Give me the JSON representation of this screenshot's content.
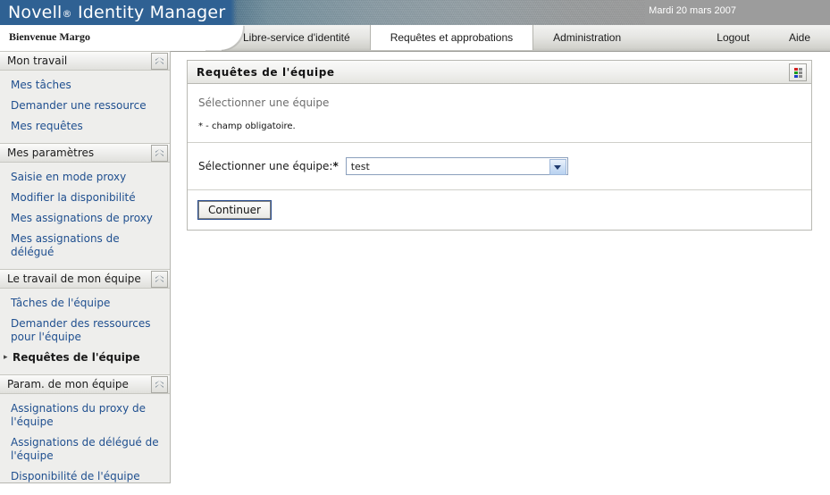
{
  "banner": {
    "product_name": "Novell",
    "registered_mark": "®",
    "product_suffix": "Identity Manager",
    "date": "Mardi 20 mars 2007"
  },
  "tabstrip": {
    "welcome": "Bienvenue Margo",
    "tabs": [
      {
        "label": "Libre-service d'identité",
        "active": false
      },
      {
        "label": "Requêtes et approbations",
        "active": true
      },
      {
        "label": "Administration",
        "active": false
      }
    ],
    "logout": "Logout",
    "help": "Aide"
  },
  "sidebar": {
    "sections": [
      {
        "title": "Mon travail",
        "collapse_icon": "chevron-up-icon",
        "items": [
          {
            "label": "Mes tâches",
            "selected": false
          },
          {
            "label": "Demander une ressource",
            "selected": false
          },
          {
            "label": "Mes requêtes",
            "selected": false
          }
        ]
      },
      {
        "title": "Mes paramètres",
        "collapse_icon": "chevron-up-icon",
        "items": [
          {
            "label": "Saisie en mode proxy",
            "selected": false
          },
          {
            "label": "Modifier la disponibilité",
            "selected": false
          },
          {
            "label": "Mes assignations de proxy",
            "selected": false
          },
          {
            "label": "Mes assignations de délégué",
            "selected": false
          }
        ]
      },
      {
        "title": "Le travail de mon équipe",
        "collapse_icon": "chevron-up-icon",
        "items": [
          {
            "label": "Tâches de l'équipe",
            "selected": false
          },
          {
            "label": "Demander des ressources pour l'équipe",
            "selected": false
          },
          {
            "label": "Requêtes de l'équipe",
            "selected": true
          }
        ]
      },
      {
        "title": "Param. de mon équipe",
        "collapse_icon": "chevron-up-icon",
        "items": [
          {
            "label": "Assignations du proxy de l'équipe",
            "selected": false
          },
          {
            "label": "Assignations de délégué de l'équipe",
            "selected": false
          },
          {
            "label": "Disponibilité de l'équipe",
            "selected": false
          }
        ]
      }
    ]
  },
  "panel": {
    "title": "Requêtes de l'équipe",
    "header_icon": "grid-view-icon",
    "instruction": "Sélectionner une équipe",
    "required_note": "* - champ obligatoire.",
    "field_label": "Sélectionner une équipe:",
    "field_required_marker": "*",
    "select_value": "test",
    "select_icon": "chevron-down-icon",
    "submit_label": "Continuer"
  },
  "colors": {
    "banner_blue": "#2f6193",
    "link_blue": "#1f4f8f",
    "icon_red": "#d22020",
    "icon_green": "#1f9b1f",
    "icon_blue": "#2040c8",
    "icon_gray": "#8a8a8a"
  }
}
